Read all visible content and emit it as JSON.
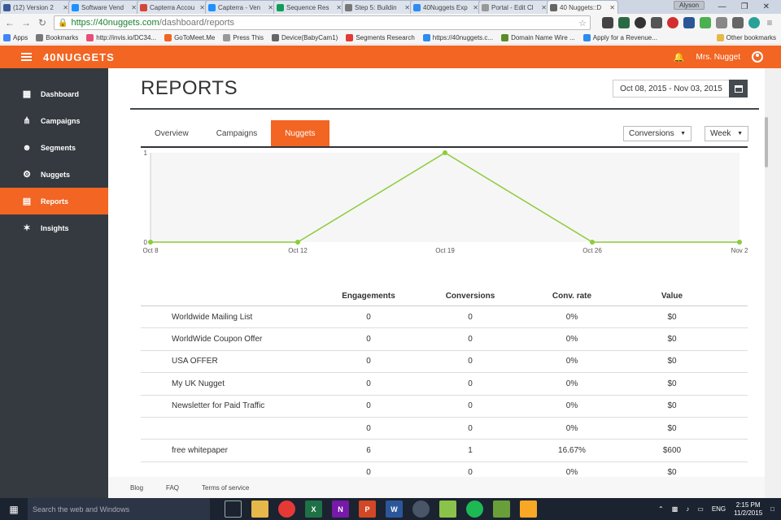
{
  "browser": {
    "tabs": [
      {
        "label": "(12) Version 2",
        "color": "#3b5998"
      },
      {
        "label": "Software Vend",
        "color": "#1e90ff"
      },
      {
        "label": "Capterra Accou",
        "color": "#d44638"
      },
      {
        "label": "Capterra - Ven",
        "color": "#1e90ff"
      },
      {
        "label": "Sequence Res",
        "color": "#0f9d58"
      },
      {
        "label": "Step 5: Buildin",
        "color": "#777777"
      },
      {
        "label": "40Nuggets Exp",
        "color": "#2d8cf0"
      },
      {
        "label": "Portal - Edit Cl",
        "color": "#999999"
      },
      {
        "label": "40 Nuggets::D",
        "color": "#666666"
      }
    ],
    "profile": "Alyson",
    "url_host": "https://40nuggets.com",
    "url_path": "/dashboard/reports",
    "bookmarks": [
      "Apps",
      "Bookmarks",
      "http://invis.io/DC34...",
      "GoToMeet.Me",
      "Press This",
      "Device(BabyCam1)",
      "Segments Research",
      "https://40nuggets.c...",
      "Domain Name Wire ...",
      "Apply for a Revenue..."
    ],
    "other_bookmarks": "Other bookmarks"
  },
  "app": {
    "logo": "40NUGGETS",
    "user_name": "Mrs. Nugget",
    "brand_color": "#f26522"
  },
  "sidebar": {
    "items": [
      {
        "label": "Dashboard",
        "icon": "dashboard-icon",
        "active": false
      },
      {
        "label": "Campaigns",
        "icon": "campaigns-icon",
        "active": false
      },
      {
        "label": "Segments",
        "icon": "segments-icon",
        "active": false
      },
      {
        "label": "Nuggets",
        "icon": "nuggets-icon",
        "active": false
      },
      {
        "label": "Reports",
        "icon": "reports-icon",
        "active": true
      },
      {
        "label": "Insights",
        "icon": "insights-icon",
        "active": false
      }
    ]
  },
  "main": {
    "title": "REPORTS",
    "date_range": "Oct 08, 2015 - Nov 03, 2015",
    "tabs": [
      "Overview",
      "Campaigns",
      "Nuggets"
    ],
    "active_tab": "Nuggets",
    "metric_select": "Conversions",
    "period_select": "Week"
  },
  "chart_data": {
    "type": "line",
    "x": [
      "Oct 8",
      "Oct 12",
      "Oct 19",
      "Oct 26",
      "Nov 2"
    ],
    "series": [
      {
        "values": [
          0,
          0,
          1,
          0,
          0
        ],
        "color": "#8ccc3a"
      }
    ],
    "y_ticks": [
      "0",
      "1"
    ],
    "ylim": [
      0,
      1
    ]
  },
  "table": {
    "headers": [
      "",
      "Engagements",
      "Conversions",
      "Conv. rate",
      "Value"
    ],
    "rows": [
      [
        "Worldwide Mailing List",
        "0",
        "0",
        "0%",
        "$0"
      ],
      [
        "WorldWide Coupon Offer",
        "0",
        "0",
        "0%",
        "$0"
      ],
      [
        "USA OFFER",
        "0",
        "0",
        "0%",
        "$0"
      ],
      [
        "My UK Nugget",
        "0",
        "0",
        "0%",
        "$0"
      ],
      [
        "Newsletter for Paid Traffic",
        "0",
        "0",
        "0%",
        "$0"
      ],
      [
        "",
        "0",
        "0",
        "0%",
        "$0"
      ],
      [
        "free whitepaper",
        "6",
        "1",
        "16.67%",
        "$600"
      ],
      [
        "",
        "0",
        "0",
        "0%",
        "$0"
      ]
    ]
  },
  "footer": {
    "links": [
      "Blog",
      "FAQ",
      "Terms of service"
    ]
  },
  "taskbar": {
    "search_placeholder": "Search the web and Windows",
    "language": "ENG",
    "time": "2:15 PM",
    "date": "11/2/2015"
  }
}
